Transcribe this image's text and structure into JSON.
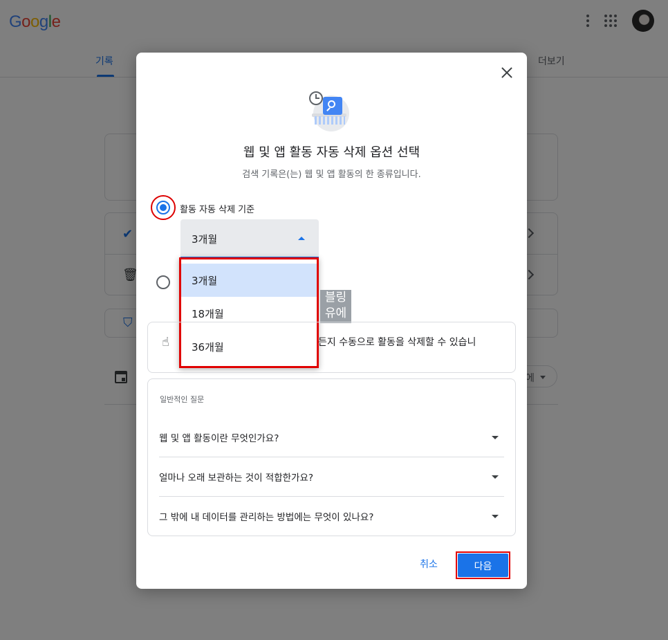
{
  "header": {
    "logo": "Google",
    "more_icon": "more-vert-icon",
    "apps_icon": "apps-grid-icon"
  },
  "tabs": {
    "history": "기록",
    "more": "더보기"
  },
  "background": {
    "filter_partial": "에"
  },
  "dialog": {
    "title": "웹 및 앱 활동 자동 삭제 옵션 선택",
    "subtitle": "검색 기록은(는) 웹 및 앱 활동의 한 종류입니다.",
    "auto_delete_label": "활동 자동 삭제 기준",
    "select_value": "3개월",
    "options": [
      "3개월",
      "18개월",
      "36개월"
    ],
    "tooltip": "블링\n유에",
    "manual_text": "든지 수동으로 활동을 삭제할 수 있습니",
    "faq": {
      "heading": "일반적인 질문",
      "items": [
        "웹 및 앱 활동이란 무엇인가요?",
        "얼마나 오래 보관하는 것이 적합한가요?",
        "그 밖에 내 데이터를 관리하는 방법에는 무엇이 있나요?"
      ]
    },
    "cancel": "취소",
    "next": "다음"
  },
  "colors": {
    "accent": "#1a73e8",
    "highlight_red": "#e00000",
    "selected_option": "#d2e3fc"
  }
}
